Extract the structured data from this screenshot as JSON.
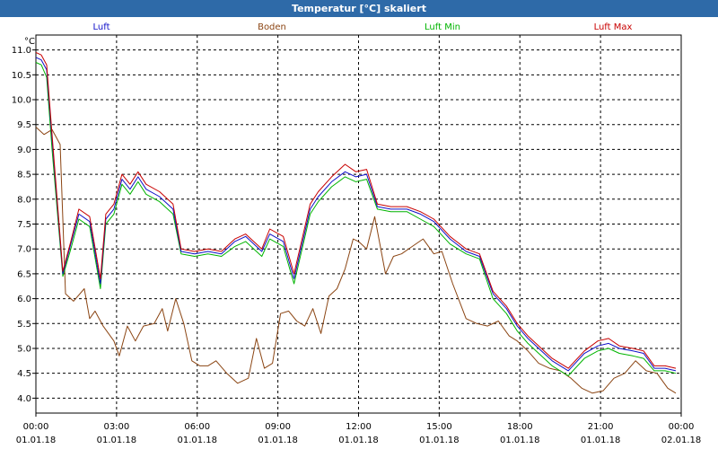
{
  "window": {
    "title": "Temperatur [°C] skaliert"
  },
  "chart_data": {
    "type": "line",
    "title": "Temperatur [°C] skaliert",
    "ylabel": "°C",
    "ylim": [
      3.7,
      11.3
    ],
    "yticks": [
      "11.0",
      "10.5",
      "10.0",
      "9.5",
      "9.0",
      "8.5",
      "8.0",
      "7.5",
      "7.0",
      "6.5",
      "6.0",
      "5.5",
      "5.0",
      "4.5",
      "4.0"
    ],
    "xlim": [
      0,
      24
    ],
    "xticks": [
      {
        "time": "00:00",
        "date": "01.01.18"
      },
      {
        "time": "03:00",
        "date": "01.01.18"
      },
      {
        "time": "06:00",
        "date": "01.01.18"
      },
      {
        "time": "09:00",
        "date": "01.01.18"
      },
      {
        "time": "12:00",
        "date": "01.01.18"
      },
      {
        "time": "15:00",
        "date": "01.01.18"
      },
      {
        "time": "18:00",
        "date": "01.01.18"
      },
      {
        "time": "21:00",
        "date": "01.01.18"
      },
      {
        "time": "00:00",
        "date": "02.01.18"
      }
    ],
    "grid": true,
    "legend_position": "top",
    "series": [
      {
        "name": "Luft",
        "color": "#1010c8",
        "x": [
          0,
          0.2,
          0.4,
          0.6,
          1.0,
          1.3,
          1.6,
          2.0,
          2.4,
          2.6,
          2.9,
          3.2,
          3.5,
          3.8,
          4.1,
          4.6,
          5.1,
          5.4,
          5.9,
          6.4,
          6.9,
          7.4,
          7.8,
          8.4,
          8.7,
          9.2,
          9.6,
          10.2,
          10.5,
          11.0,
          11.5,
          11.9,
          12.3,
          12.7,
          13.2,
          13.8,
          14.3,
          14.8,
          15.4,
          16.0,
          16.5,
          17.0,
          17.5,
          17.9,
          18.3,
          18.8,
          19.2,
          19.8,
          20.4,
          20.9,
          21.3,
          21.7,
          22.2,
          22.6,
          23.0,
          23.4,
          23.8
        ],
        "values": [
          10.85,
          10.8,
          10.6,
          9.2,
          6.5,
          7.1,
          7.7,
          7.55,
          6.3,
          7.6,
          7.8,
          8.4,
          8.2,
          8.45,
          8.2,
          8.05,
          7.8,
          6.95,
          6.9,
          6.95,
          6.9,
          7.15,
          7.25,
          6.95,
          7.3,
          7.15,
          6.4,
          7.8,
          8.05,
          8.35,
          8.55,
          8.45,
          8.5,
          7.85,
          7.8,
          7.8,
          7.7,
          7.55,
          7.2,
          6.95,
          6.85,
          6.1,
          5.8,
          5.45,
          5.2,
          4.95,
          4.75,
          4.55,
          4.9,
          5.05,
          5.1,
          5.0,
          4.95,
          4.9,
          4.6,
          4.6,
          4.55
        ]
      },
      {
        "name": "Boden",
        "color": "#8b4513",
        "x": [
          0,
          0.3,
          0.6,
          0.9,
          1.1,
          1.4,
          1.8,
          2.0,
          2.2,
          2.5,
          2.9,
          3.1,
          3.4,
          3.7,
          4.0,
          4.4,
          4.7,
          4.9,
          5.2,
          5.5,
          5.8,
          6.1,
          6.4,
          6.7,
          7.1,
          7.5,
          7.9,
          8.2,
          8.5,
          8.8,
          9.1,
          9.4,
          9.7,
          10.0,
          10.3,
          10.6,
          10.9,
          11.2,
          11.5,
          11.8,
          12.0,
          12.3,
          12.6,
          13.0,
          13.3,
          13.6,
          14.0,
          14.4,
          14.8,
          15.1,
          15.5,
          16.0,
          16.4,
          16.8,
          17.2,
          17.6,
          17.9,
          18.3,
          18.7,
          19.1,
          19.5,
          19.9,
          20.3,
          20.7,
          21.1,
          21.5,
          21.9,
          22.3,
          22.7,
          23.1,
          23.5,
          23.8
        ],
        "values": [
          9.45,
          9.3,
          9.4,
          9.1,
          6.1,
          5.95,
          6.2,
          5.6,
          5.75,
          5.45,
          5.15,
          4.85,
          5.45,
          5.15,
          5.45,
          5.5,
          5.8,
          5.35,
          6.0,
          5.5,
          4.75,
          4.65,
          4.65,
          4.75,
          4.5,
          4.3,
          4.4,
          5.2,
          4.6,
          4.7,
          5.7,
          5.75,
          5.55,
          5.45,
          5.8,
          5.3,
          6.05,
          6.2,
          6.6,
          7.2,
          7.15,
          7.0,
          7.65,
          6.5,
          6.85,
          6.9,
          7.05,
          7.2,
          6.9,
          6.95,
          6.3,
          5.6,
          5.5,
          5.45,
          5.55,
          5.25,
          5.15,
          4.95,
          4.7,
          4.6,
          4.55,
          4.4,
          4.2,
          4.1,
          4.15,
          4.4,
          4.5,
          4.75,
          4.55,
          4.5,
          4.2,
          4.1
        ]
      },
      {
        "name": "Luft Min",
        "color": "#00b400",
        "x": [
          0,
          0.2,
          0.4,
          0.6,
          1.0,
          1.3,
          1.6,
          2.0,
          2.4,
          2.6,
          2.9,
          3.2,
          3.5,
          3.8,
          4.1,
          4.6,
          5.1,
          5.4,
          5.9,
          6.4,
          6.9,
          7.4,
          7.8,
          8.4,
          8.7,
          9.2,
          9.6,
          10.2,
          10.5,
          11.0,
          11.5,
          11.9,
          12.3,
          12.7,
          13.2,
          13.8,
          14.3,
          14.8,
          15.4,
          16.0,
          16.5,
          17.0,
          17.5,
          17.9,
          18.3,
          18.8,
          19.2,
          19.8,
          20.4,
          20.9,
          21.3,
          21.7,
          22.2,
          22.6,
          23.0,
          23.4,
          23.8
        ],
        "values": [
          10.75,
          10.7,
          10.45,
          9.0,
          6.45,
          7.0,
          7.6,
          7.45,
          6.2,
          7.5,
          7.7,
          8.3,
          8.1,
          8.35,
          8.1,
          7.95,
          7.7,
          6.9,
          6.85,
          6.9,
          6.85,
          7.05,
          7.15,
          6.85,
          7.2,
          7.05,
          6.3,
          7.7,
          7.95,
          8.25,
          8.45,
          8.35,
          8.4,
          7.8,
          7.75,
          7.75,
          7.6,
          7.45,
          7.1,
          6.9,
          6.8,
          6.0,
          5.7,
          5.35,
          5.1,
          4.85,
          4.65,
          4.45,
          4.8,
          4.95,
          5.0,
          4.9,
          4.85,
          4.8,
          4.55,
          4.55,
          4.5
        ]
      },
      {
        "name": "Luft Max",
        "color": "#c80000",
        "x": [
          0,
          0.2,
          0.4,
          0.6,
          1.0,
          1.3,
          1.6,
          2.0,
          2.4,
          2.6,
          2.9,
          3.2,
          3.5,
          3.8,
          4.1,
          4.6,
          5.1,
          5.4,
          5.9,
          6.4,
          6.9,
          7.4,
          7.8,
          8.4,
          8.7,
          9.2,
          9.6,
          10.2,
          10.5,
          11.0,
          11.5,
          11.9,
          12.3,
          12.7,
          13.2,
          13.8,
          14.3,
          14.8,
          15.4,
          16.0,
          16.5,
          17.0,
          17.5,
          17.9,
          18.3,
          18.8,
          19.2,
          19.8,
          20.4,
          20.9,
          21.3,
          21.7,
          22.2,
          22.6,
          23.0,
          23.4,
          23.8
        ],
        "values": [
          10.95,
          10.9,
          10.7,
          9.3,
          6.55,
          7.15,
          7.8,
          7.65,
          6.4,
          7.7,
          7.9,
          8.5,
          8.3,
          8.55,
          8.3,
          8.15,
          7.9,
          7.0,
          6.95,
          7.0,
          6.95,
          7.2,
          7.3,
          7.0,
          7.4,
          7.25,
          6.5,
          7.9,
          8.15,
          8.45,
          8.7,
          8.55,
          8.6,
          7.9,
          7.85,
          7.85,
          7.75,
          7.6,
          7.25,
          7.0,
          6.9,
          6.15,
          5.85,
          5.5,
          5.25,
          5.0,
          4.8,
          4.6,
          4.95,
          5.15,
          5.2,
          5.05,
          5.0,
          4.95,
          4.65,
          4.65,
          4.6
        ]
      }
    ]
  }
}
